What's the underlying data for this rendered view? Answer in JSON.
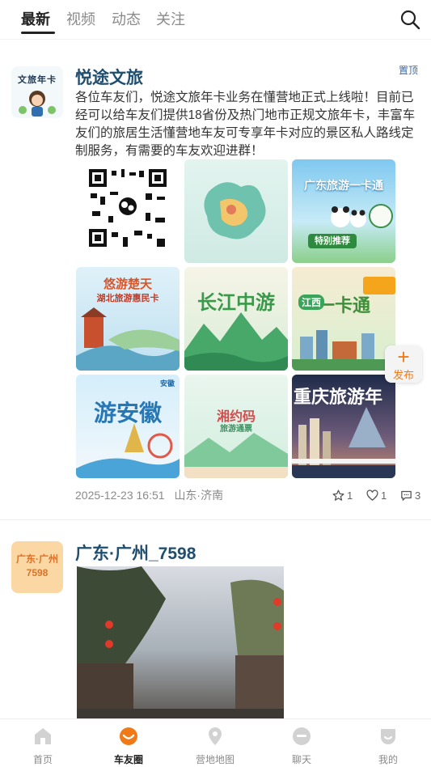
{
  "top_tabs": {
    "latest": "最新",
    "video": "视频",
    "moments": "动态",
    "following": "关注"
  },
  "post1": {
    "avatar_text": "文旅年卡",
    "username": "悦途文旅",
    "pinned_label": "置顶",
    "text": "各位车友们，悦途文旅年卡业务在懂营地正式上线啦！目前已经可以给车友们提供18省份及热门地市正规文旅年卡，丰富车友们的旅居生活懂营地车友可专享年卡对应的景区私人路线定制服务，有需要的车友欢迎进群！",
    "images": [
      {
        "label": "",
        "icon": "qr-code"
      },
      {
        "label": "",
        "icon": "map-illustration"
      },
      {
        "label": "广东旅游一卡通",
        "sub": "特别推荐"
      },
      {
        "label": "悠游楚天",
        "sub": "湖北旅游惠民卡"
      },
      {
        "label": "长江中游"
      },
      {
        "label": "一卡通",
        "sub": "江西"
      },
      {
        "label": "游安徽",
        "sub": "安徽"
      },
      {
        "label": "湘约码",
        "sub": "旅游通票"
      },
      {
        "label": "重庆旅游年"
      }
    ],
    "timestamp": "2025-12-23 16:51",
    "location": "山东·济南",
    "favorites": "1",
    "likes": "1",
    "comments": "3"
  },
  "fab": {
    "label": "发布"
  },
  "post2": {
    "avatar_text": "广东·广州 7598",
    "username": "广东·广州_7598"
  },
  "bottom_nav": {
    "home": "首页",
    "circle": "车友圈",
    "map": "营地地图",
    "chat": "聊天",
    "mine": "我的"
  },
  "colors": {
    "accent": "#f07a18",
    "username": "#1f4e6f",
    "muted": "#8a8a8a"
  }
}
